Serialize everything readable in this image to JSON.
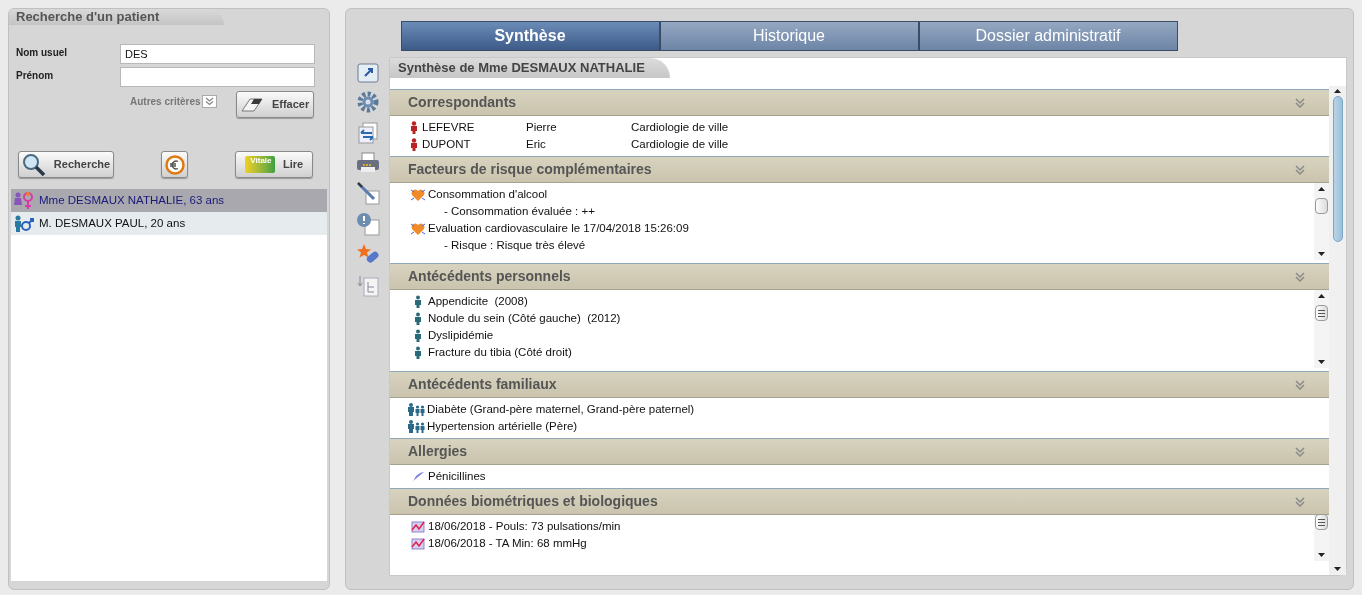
{
  "search_panel": {
    "title": "Recherche d'un patient",
    "fields": [
      {
        "label": "Nom usuel",
        "value": "DES"
      },
      {
        "label": "Prénom"
      }
    ],
    "more_criteria": "Autres critères",
    "clear_button": "Effacer",
    "search_button": "Recherche",
    "read_button": "Lire",
    "card_label": "Vitale",
    "patients": [
      {
        "name": "Mme DESMAUX NATHALIE, 63 ans",
        "kind": "female",
        "selected": true
      },
      {
        "name": "M. DESMAUX PAUL, 20 ans",
        "kind": "male",
        "selected": false
      }
    ]
  },
  "tabs": [
    {
      "label": "Synthèse",
      "selected": true
    },
    {
      "label": "Historique",
      "selected": false
    },
    {
      "label": "Dossier administratif",
      "selected": false
    }
  ],
  "summary": {
    "title": "Synthèse de Mme DESMAUX NATHALIE",
    "sections": [
      {
        "title": "Correspondants",
        "kind": "contacts",
        "scrollable": false,
        "rows": [
          {
            "last_name": "LEFEVRE",
            "first_name": "Pierre",
            "specialty": "Cardiologie de ville"
          },
          {
            "last_name": "DUPONT",
            "first_name": "Eric",
            "specialty": "Cardiologie de ville"
          }
        ]
      },
      {
        "title": "Facteurs de risque complémentaires",
        "kind": "risk",
        "scrollable": true,
        "items": [
          {
            "text": "Consommation d'alcool",
            "details": [
              "- Consommation évaluée : ++"
            ]
          },
          {
            "text": "Evaluation cardiovasculaire le 17/04/2018 15:26:09",
            "details": [
              "- Risque : Risque très élevé"
            ]
          }
        ]
      },
      {
        "title": "Antécédents personnels",
        "kind": "personal",
        "scrollable": true,
        "items": [
          {
            "text": "Appendicite  (2008)"
          },
          {
            "text": "Nodule du sein (Côté gauche)  (2012)"
          },
          {
            "text": "Dyslipidémie"
          },
          {
            "text": "Fracture du tibia (Côté droit)"
          }
        ]
      },
      {
        "title": "Antécédents familiaux",
        "kind": "family",
        "scrollable": false,
        "items": [
          {
            "text": "Diabète (Grand-père maternel, Grand-père paternel)"
          },
          {
            "text": "Hypertension artérielle (Père)"
          }
        ]
      },
      {
        "title": "Allergies",
        "kind": "allergy",
        "scrollable": false,
        "items": [
          {
            "text": "Pénicillines"
          }
        ]
      },
      {
        "title": "Données biométriques et biologiques",
        "kind": "biometric",
        "scrollable": true,
        "items": [
          {
            "text": "18/06/2018 - Pouls: 73 pulsations/min"
          },
          {
            "text": "18/06/2018 - TA Min: 68 mmHg"
          }
        ]
      }
    ]
  }
}
